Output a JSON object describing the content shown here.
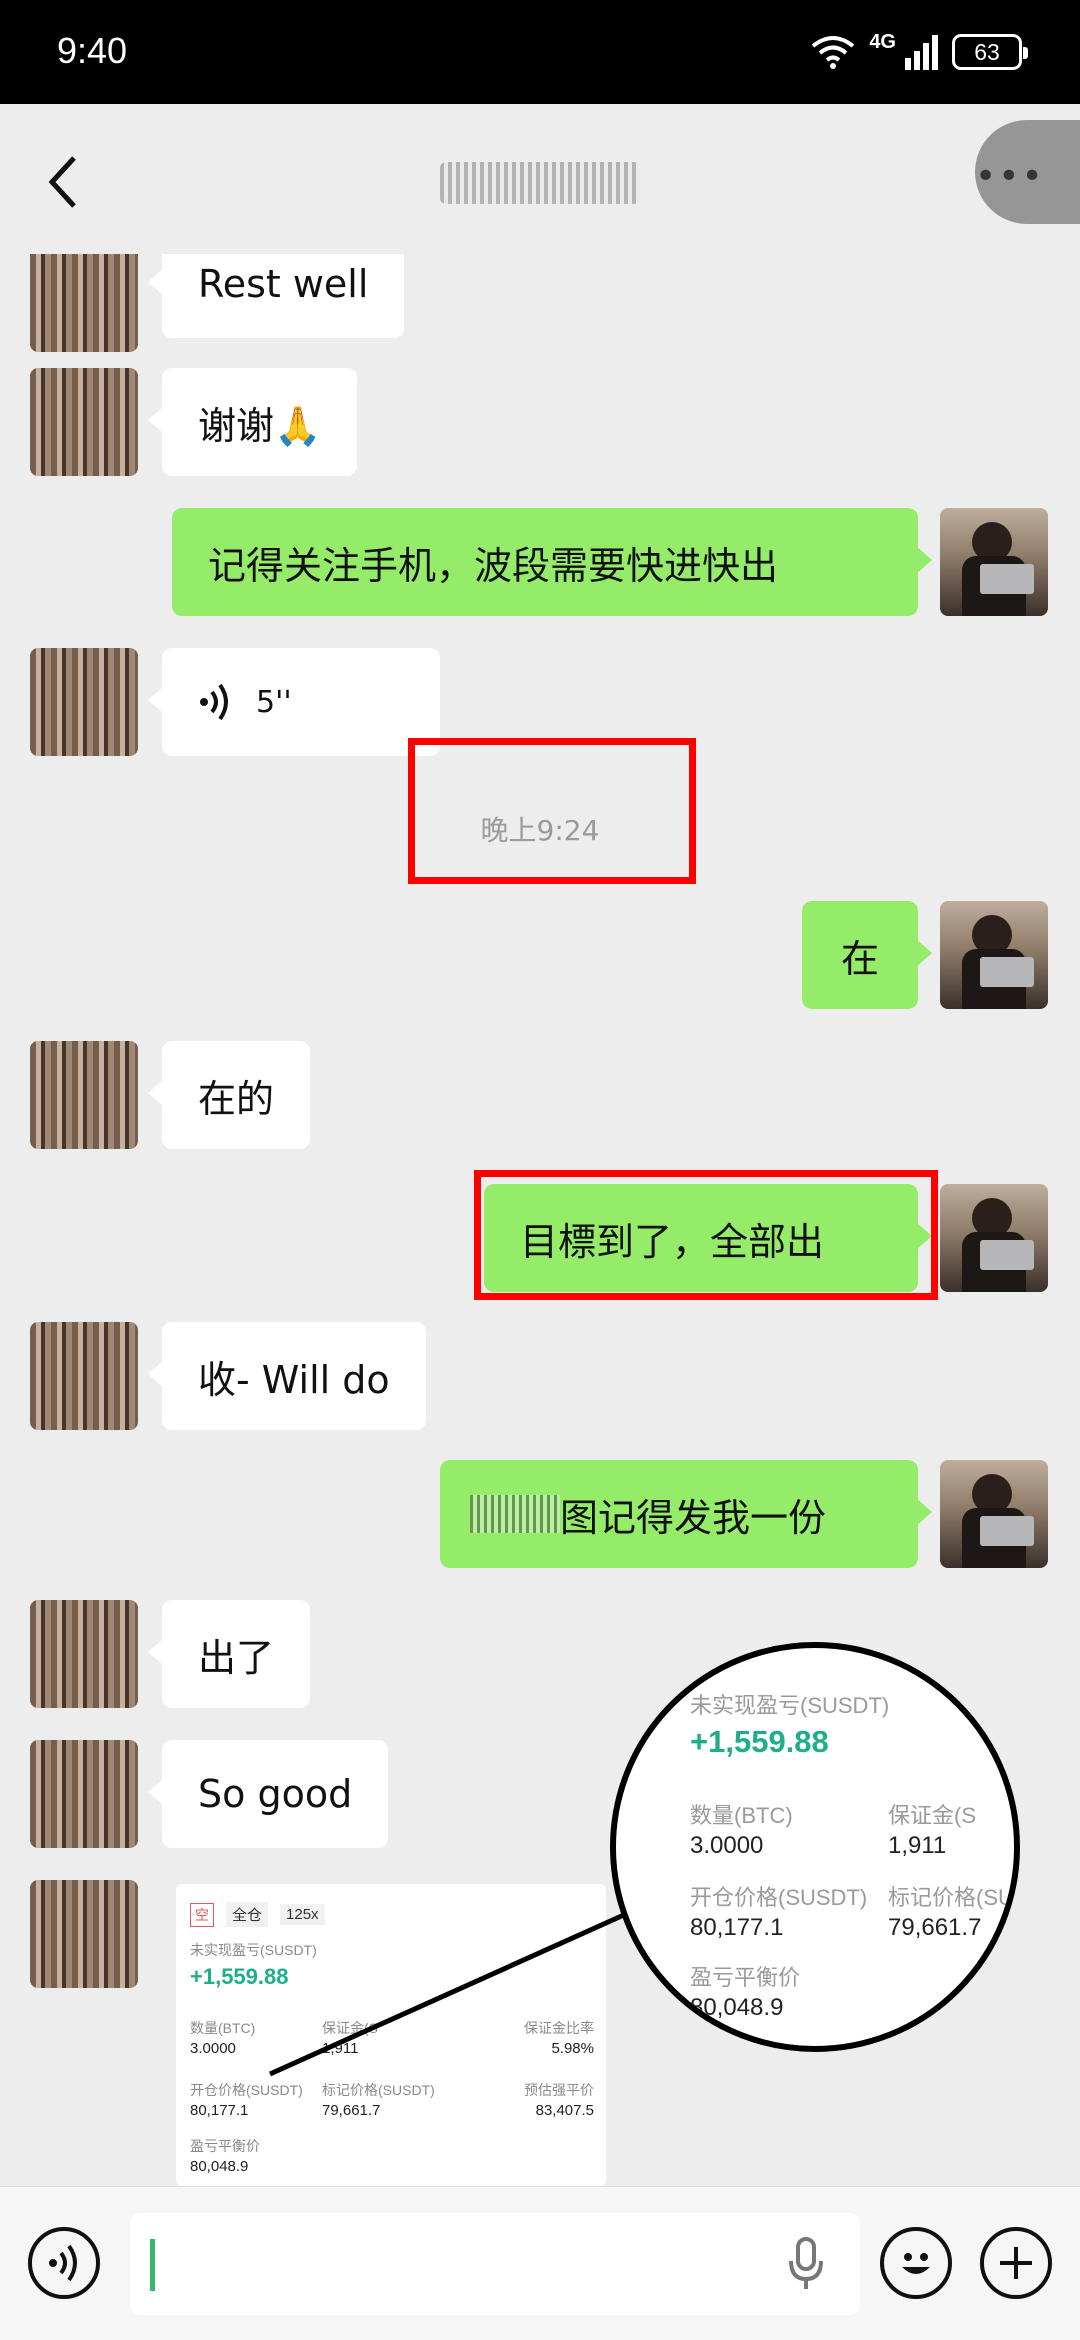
{
  "status": {
    "time": "9:40",
    "network": "4G",
    "battery": "63"
  },
  "messages": [
    {
      "side": "in",
      "text": "Rest  well"
    },
    {
      "side": "in",
      "text": "谢谢🙏"
    },
    {
      "side": "out",
      "text": "记得关注手机，波段需要快进快出"
    },
    {
      "side": "in",
      "type": "voice",
      "text": "5''"
    },
    {
      "side": "out",
      "text": "在"
    },
    {
      "side": "in",
      "text": "在的"
    },
    {
      "side": "out",
      "text": "目標到了，全部出"
    },
    {
      "side": "in",
      "text": "收- Will do"
    },
    {
      "side": "out",
      "text": "图记得发我一份"
    },
    {
      "side": "in",
      "text": "出了"
    },
    {
      "side": "in",
      "text": "So  good"
    }
  ],
  "timestamp": "晚上9:24",
  "trade_card": {
    "tag_short": "空",
    "mode": "全仓",
    "leverage": "125x",
    "pnl_label": "未实现盈亏(SUSDT)",
    "pnl_value": "+1,559.88",
    "qty_label": "数量(BTC)",
    "qty_value": "3.0000",
    "margin_label": "保证金(S",
    "margin_value": "1,911",
    "margin_ratio_label": "保证金比率",
    "margin_ratio_value": "5.98%",
    "open_price_label": "开仓价格(SUSDT)",
    "open_price_value": "80,177.1",
    "mark_price_label": "标记价格(SUSDT)",
    "mark_price_value": "79,661.7",
    "liq_price_label": "预估强平价",
    "liq_price_value": "83,407.5",
    "breakeven_label": "盈亏平衡价",
    "breakeven_value": "80,048.9"
  },
  "zoom": {
    "pnl_label": "未实现盈亏(SUSDT)",
    "pnl_value": "+1,559.88",
    "qty_label": "数量(BTC)",
    "qty_value": "3.0000",
    "margin_label": "保证金(S",
    "margin_value": "1,911",
    "open_label": "开仓价格(SUSDT)",
    "open_value": "80,177.1",
    "mark_label": "标记价格(SU",
    "mark_value": "79,661.7",
    "be_label": "盈亏平衡价",
    "be_value": "80,048.9"
  },
  "colors": {
    "out_bubble": "#95ec69",
    "in_bubble": "#ffffff",
    "highlight": "#ff0000",
    "profit": "#1fae8a"
  }
}
